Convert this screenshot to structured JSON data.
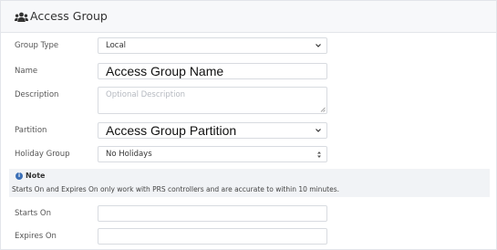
{
  "header": {
    "title": "Access Group",
    "icon": "users-icon"
  },
  "form": {
    "group_type": {
      "label": "Group Type",
      "value": "Local"
    },
    "name": {
      "label": "Name",
      "value": "Access Group Name"
    },
    "description": {
      "label": "Description",
      "placeholder": "Optional Description"
    },
    "partition": {
      "label": "Partition",
      "value": "Access Group Partition"
    },
    "holiday_group": {
      "label": "Holiday Group",
      "value": "No Holidays"
    },
    "starts_on": {
      "label": "Starts On",
      "value": ""
    },
    "expires_on": {
      "label": "Expires On",
      "value": ""
    }
  },
  "note": {
    "icon": "info-icon",
    "title": "Note",
    "text": "Starts On and Expires On only work with PRS controllers and are accurate to within 10 minutes."
  }
}
